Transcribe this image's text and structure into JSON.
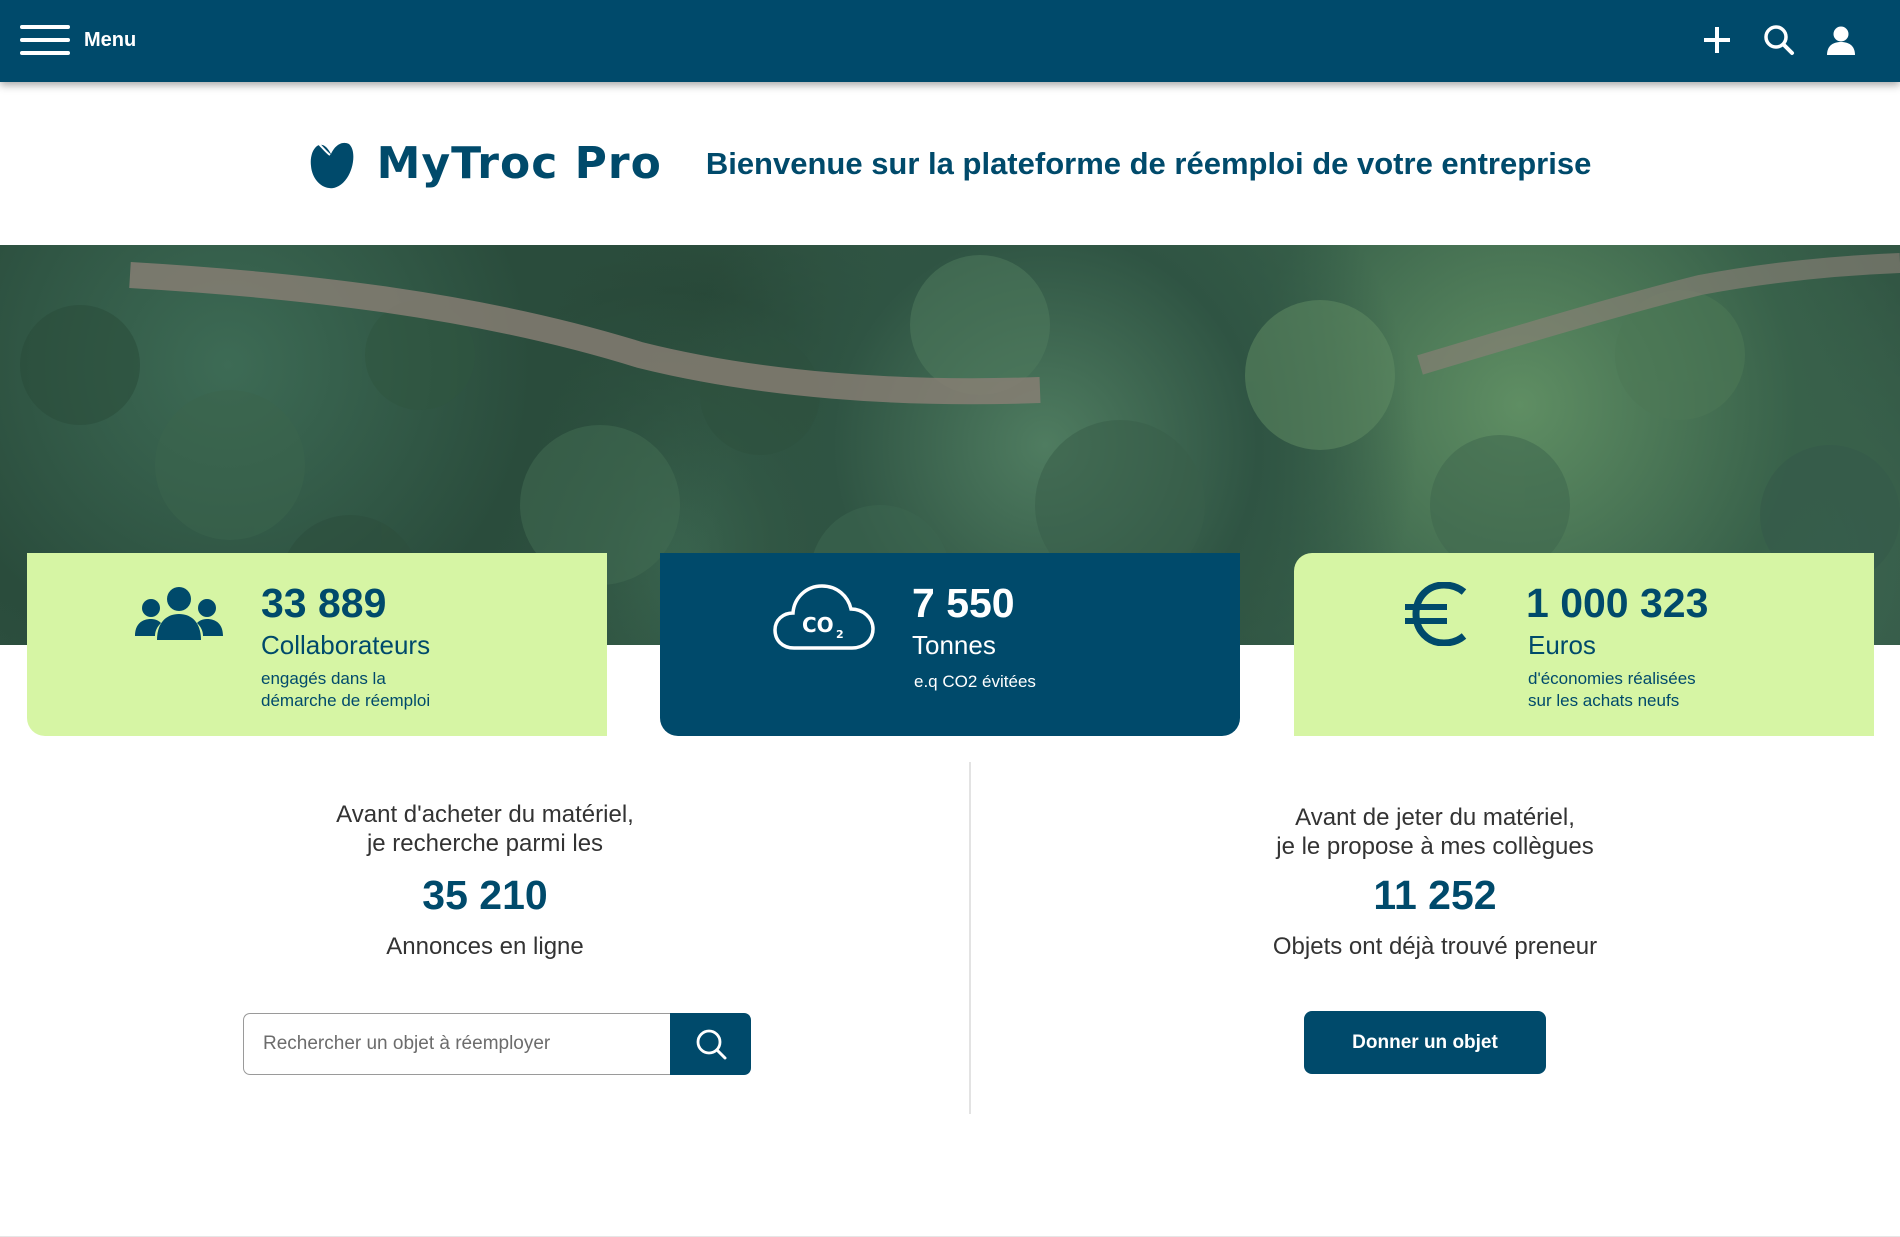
{
  "topbar": {
    "menu_label": "Menu",
    "icons": [
      "plus-icon",
      "search-icon",
      "user-icon"
    ]
  },
  "brand": {
    "name": "MyTroc Pro",
    "tagline": "Bienvenue sur la plateforme de réemploi de votre entreprise"
  },
  "stats": [
    {
      "icon": "people-icon",
      "value": "33 889",
      "unit": "Collaborateurs",
      "sub_line1": "engagés dans la",
      "sub_line2": "démarche de réemploi"
    },
    {
      "icon": "co2-cloud-icon",
      "value": "7 550",
      "unit": "Tonnes",
      "sub_line1": "e.q CO2 évitées",
      "sub_line2": ""
    },
    {
      "icon": "euro-icon",
      "value": "1 000 323",
      "unit": "Euros",
      "sub_line1": "d'économies réalisées",
      "sub_line2": "sur les achats neufs"
    }
  ],
  "co2_icon_text": "CO",
  "co2_icon_sub": "2",
  "left_section": {
    "intro_line1": "Avant d'acheter du matériel,",
    "intro_line2": "je recherche parmi les",
    "count": "35 210",
    "caption": "Annonces en ligne",
    "search_placeholder": "Rechercher un objet à réemployer"
  },
  "right_section": {
    "intro_line1": "Avant de jeter du matériel,",
    "intro_line2": "je le propose à mes collègues",
    "count": "11 252",
    "caption": "Objets ont déjà trouvé preneur",
    "button_label": "Donner un objet"
  },
  "colors": {
    "primary": "#004a6b",
    "accent_green": "#d6f5a4"
  }
}
